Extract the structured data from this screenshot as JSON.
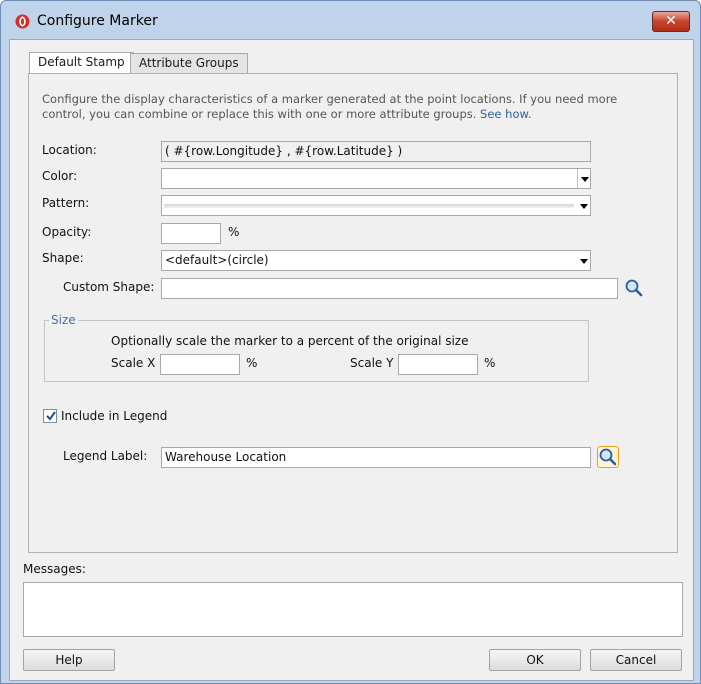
{
  "window": {
    "title": "Configure Marker",
    "close_label": "✕"
  },
  "tabs": [
    {
      "label": "Default Stamp",
      "active": true
    },
    {
      "label": "Attribute Groups",
      "active": false
    }
  ],
  "description": {
    "text": "Configure the display characteristics of a marker generated at the point locations. If you need more control, you can combine or replace this with one or more attribute groups.",
    "link": "See how."
  },
  "form": {
    "location_label": "Location:",
    "location_value": "( #{row.Longitude} , #{row.Latitude} )",
    "color_label": "Color:",
    "color_value": "",
    "pattern_label": "Pattern:",
    "opacity_label": "Opacity:",
    "opacity_value": "",
    "opacity_unit": "%",
    "shape_label": "Shape:",
    "shape_value": "<default>(circle)",
    "custom_shape_label": "Custom Shape:",
    "custom_shape_value": ""
  },
  "size": {
    "legend": "Size",
    "hint": "Optionally scale the marker to a percent of the original size",
    "scale_x_label": "Scale X",
    "scale_x_value": "",
    "scale_y_label": "Scale Y",
    "scale_y_value": "",
    "unit": "%"
  },
  "legend": {
    "include_label": "Include in Legend",
    "include_checked": true,
    "label_label": "Legend Label:",
    "label_value": "Warehouse Location"
  },
  "messages": {
    "label": "Messages:",
    "value": ""
  },
  "buttons": {
    "help": "Help",
    "ok": "OK",
    "cancel": "Cancel"
  },
  "colors": {
    "link": "#2f5f9e",
    "size_legend": "#4d6fa0",
    "focus": "#e9a21f"
  }
}
